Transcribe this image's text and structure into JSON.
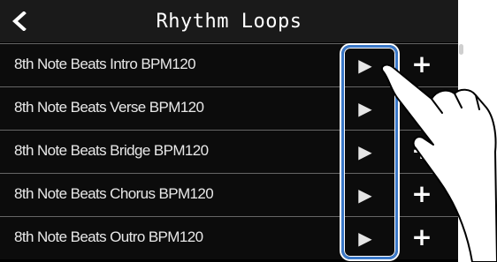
{
  "header": {
    "title": "Rhythm Loops",
    "back_icon": "chevron-left-icon"
  },
  "loops": [
    {
      "label": "8th Note Beats Intro BPM120"
    },
    {
      "label": "8th Note Beats Verse BPM120"
    },
    {
      "label": "8th Note Beats Bridge BPM120"
    },
    {
      "label": "8th Note Beats Chorus BPM120"
    },
    {
      "label": "8th Note Beats Outro BPM120"
    }
  ],
  "icons": {
    "play": "play-icon",
    "add": "plus-icon"
  },
  "glyphs": {
    "play": "▶",
    "add": "+"
  },
  "colors": {
    "highlight": "#3a78c8",
    "background": "#000000",
    "text": "#e8e8e8"
  }
}
